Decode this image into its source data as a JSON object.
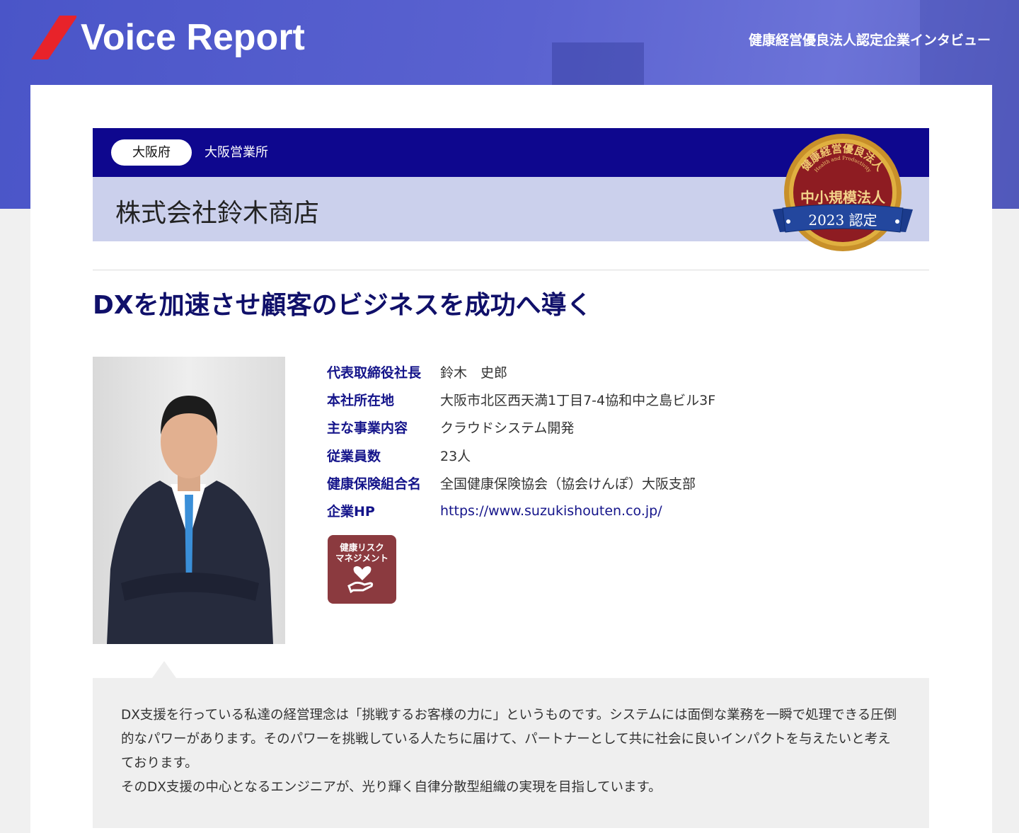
{
  "header": {
    "logo": "Voice Report",
    "tagline": "健康経営優良法人認定企業インタビュー"
  },
  "company": {
    "prefecture": "大阪府",
    "office": "大阪営業所",
    "name": "株式会社鈴木商店"
  },
  "badge": {
    "arc_text": "健康経営優良法人",
    "arc_sub": "Health and Productivity",
    "category": "中小規模法人",
    "year": "2023 認定"
  },
  "headline": "DXを加速させ顧客のビジネスを成功へ導く",
  "info": [
    {
      "label": "代表取締役社長",
      "value": "鈴木　史郎"
    },
    {
      "label": "本社所在地",
      "value": "大阪市北区西天満1丁目7-4協和中之島ビル3F"
    },
    {
      "label": "主な事業内容",
      "value": "クラウドシステム開発"
    },
    {
      "label": "従業員数",
      "value": "23人"
    },
    {
      "label": "健康保険組合名",
      "value": "全国健康保険協会（協会けんぽ）大阪支部"
    },
    {
      "label": "企業HP",
      "value": "https://www.suzukishouten.co.jp/"
    }
  ],
  "risk_icon": {
    "line1": "健康リスク",
    "line2": "マネジメント"
  },
  "quote": [
    "DX支援を行っている私達の経営理念は「挑戦するお客様の力に」というものです。システムには面倒な業務を一瞬で処理できる圧倒的なパワーがあります。そのパワーを挑戦している人たちに届けて、パートナーとして共に社会に良いインパクトを与えたいと考えております。",
    "そのDX支援の中心となるエンジニアが、光り輝く自律分散型組織の実現を目指しています。"
  ],
  "colors": {
    "navy": "#0e078e",
    "accent": "#e8232a",
    "risk": "#8b3a3f"
  }
}
